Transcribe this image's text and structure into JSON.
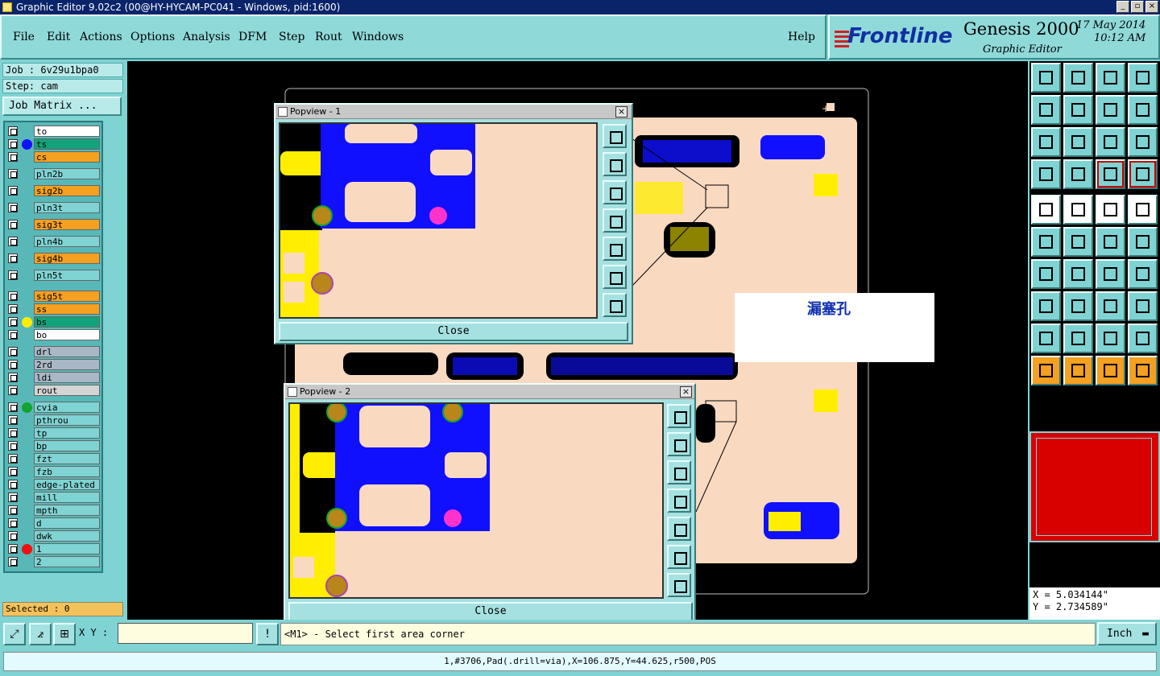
{
  "window": {
    "title": "Graphic Editor 9.02c2 (00@HY-HYCAM-PC041 - Windows, pid:1600)"
  },
  "menu": [
    "File",
    "Edit",
    "Actions",
    "Options",
    "Analysis",
    "DFM",
    "Step",
    "Rout",
    "Windows"
  ],
  "help_label": "Help",
  "brand": {
    "logo": "Frontline",
    "product": "Genesis 2000",
    "subtitle": "Graphic Editor",
    "date": "17 May 2014",
    "time": "10:12 AM"
  },
  "job": {
    "job_line": "Job : 6v29u1bpa0",
    "step_line": "Step: cam",
    "job_matrix": "Job Matrix ..."
  },
  "layers": [
    {
      "name": "to",
      "bg": "#ffffff",
      "dot": ""
    },
    {
      "name": "ts",
      "bg": "#13a37a",
      "dot": "#1010ff"
    },
    {
      "name": "cs",
      "bg": "#f4a020",
      "dot": ""
    },
    {
      "name": "pln2b",
      "bg": "#7fd3d3",
      "dot": ""
    },
    {
      "name": "sig2b",
      "bg": "#f4a020",
      "dot": ""
    },
    {
      "name": "pln3t",
      "bg": "#7fd3d3",
      "dot": ""
    },
    {
      "name": "sig3t",
      "bg": "#f4a020",
      "dot": ""
    },
    {
      "name": "pln4b",
      "bg": "#7fd3d3",
      "dot": ""
    },
    {
      "name": "sig4b",
      "bg": "#f4a020",
      "dot": ""
    },
    {
      "name": "pln5t",
      "bg": "#7fd3d3",
      "dot": ""
    },
    {
      "name": "sig5t",
      "bg": "#f4a020",
      "dot": ""
    },
    {
      "name": "ss",
      "bg": "#f4a020",
      "dot": ""
    },
    {
      "name": "bs",
      "bg": "#13a37a",
      "dot": "#ffee00"
    },
    {
      "name": "bo",
      "bg": "#ffffff",
      "dot": ""
    },
    {
      "name": "drl",
      "bg": "#a9b7c6",
      "dot": ""
    },
    {
      "name": "2rd",
      "bg": "#a9b7c6",
      "dot": ""
    },
    {
      "name": "ldi",
      "bg": "#a9b7c6",
      "dot": ""
    },
    {
      "name": "rout",
      "bg": "#d4d4d4",
      "dot": ""
    },
    {
      "name": "cvia",
      "bg": "#7fd3d3",
      "dot": "#13a330"
    },
    {
      "name": "pthrou",
      "bg": "#7fd3d3",
      "dot": ""
    },
    {
      "name": "tp",
      "bg": "#7fd3d3",
      "dot": ""
    },
    {
      "name": "bp",
      "bg": "#7fd3d3",
      "dot": ""
    },
    {
      "name": "fzt",
      "bg": "#7fd3d3",
      "dot": ""
    },
    {
      "name": "fzb",
      "bg": "#7fd3d3",
      "dot": ""
    },
    {
      "name": "edge-plated",
      "bg": "#7fd3d3",
      "dot": ""
    },
    {
      "name": "mill",
      "bg": "#7fd3d3",
      "dot": ""
    },
    {
      "name": "mpth",
      "bg": "#7fd3d3",
      "dot": ""
    },
    {
      "name": "d",
      "bg": "#7fd3d3",
      "dot": ""
    },
    {
      "name": "dwk",
      "bg": "#7fd3d3",
      "dot": ""
    },
    {
      "name": "1",
      "bg": "#7fd3d3",
      "dot": "#ee1010"
    },
    {
      "name": "2",
      "bg": "#7fd3d3",
      "dot": ""
    }
  ],
  "selected_label": "Selected : 0",
  "popview1": {
    "title": "Popview - 1",
    "close_label": "Close"
  },
  "popview2": {
    "title": "Popview - 2",
    "close_label": "Close"
  },
  "annotation": "漏塞孔",
  "coords": {
    "x": "X = 5.034144\"",
    "y": "Y = 2.734589\""
  },
  "xy_label": "X Y :",
  "xy_value": "",
  "prompt": "<M1> - Select first area corner",
  "unit": "Inch",
  "status": "1,#3706,Pad(.drill=via),X=106.875,Y=44.625,r500,POS",
  "colors": {
    "board": "#fad9c1",
    "copper": "#1010ff",
    "soldermask": "#ffee00",
    "panel": "#7fd3d3",
    "titlebar": "#0a246a"
  }
}
